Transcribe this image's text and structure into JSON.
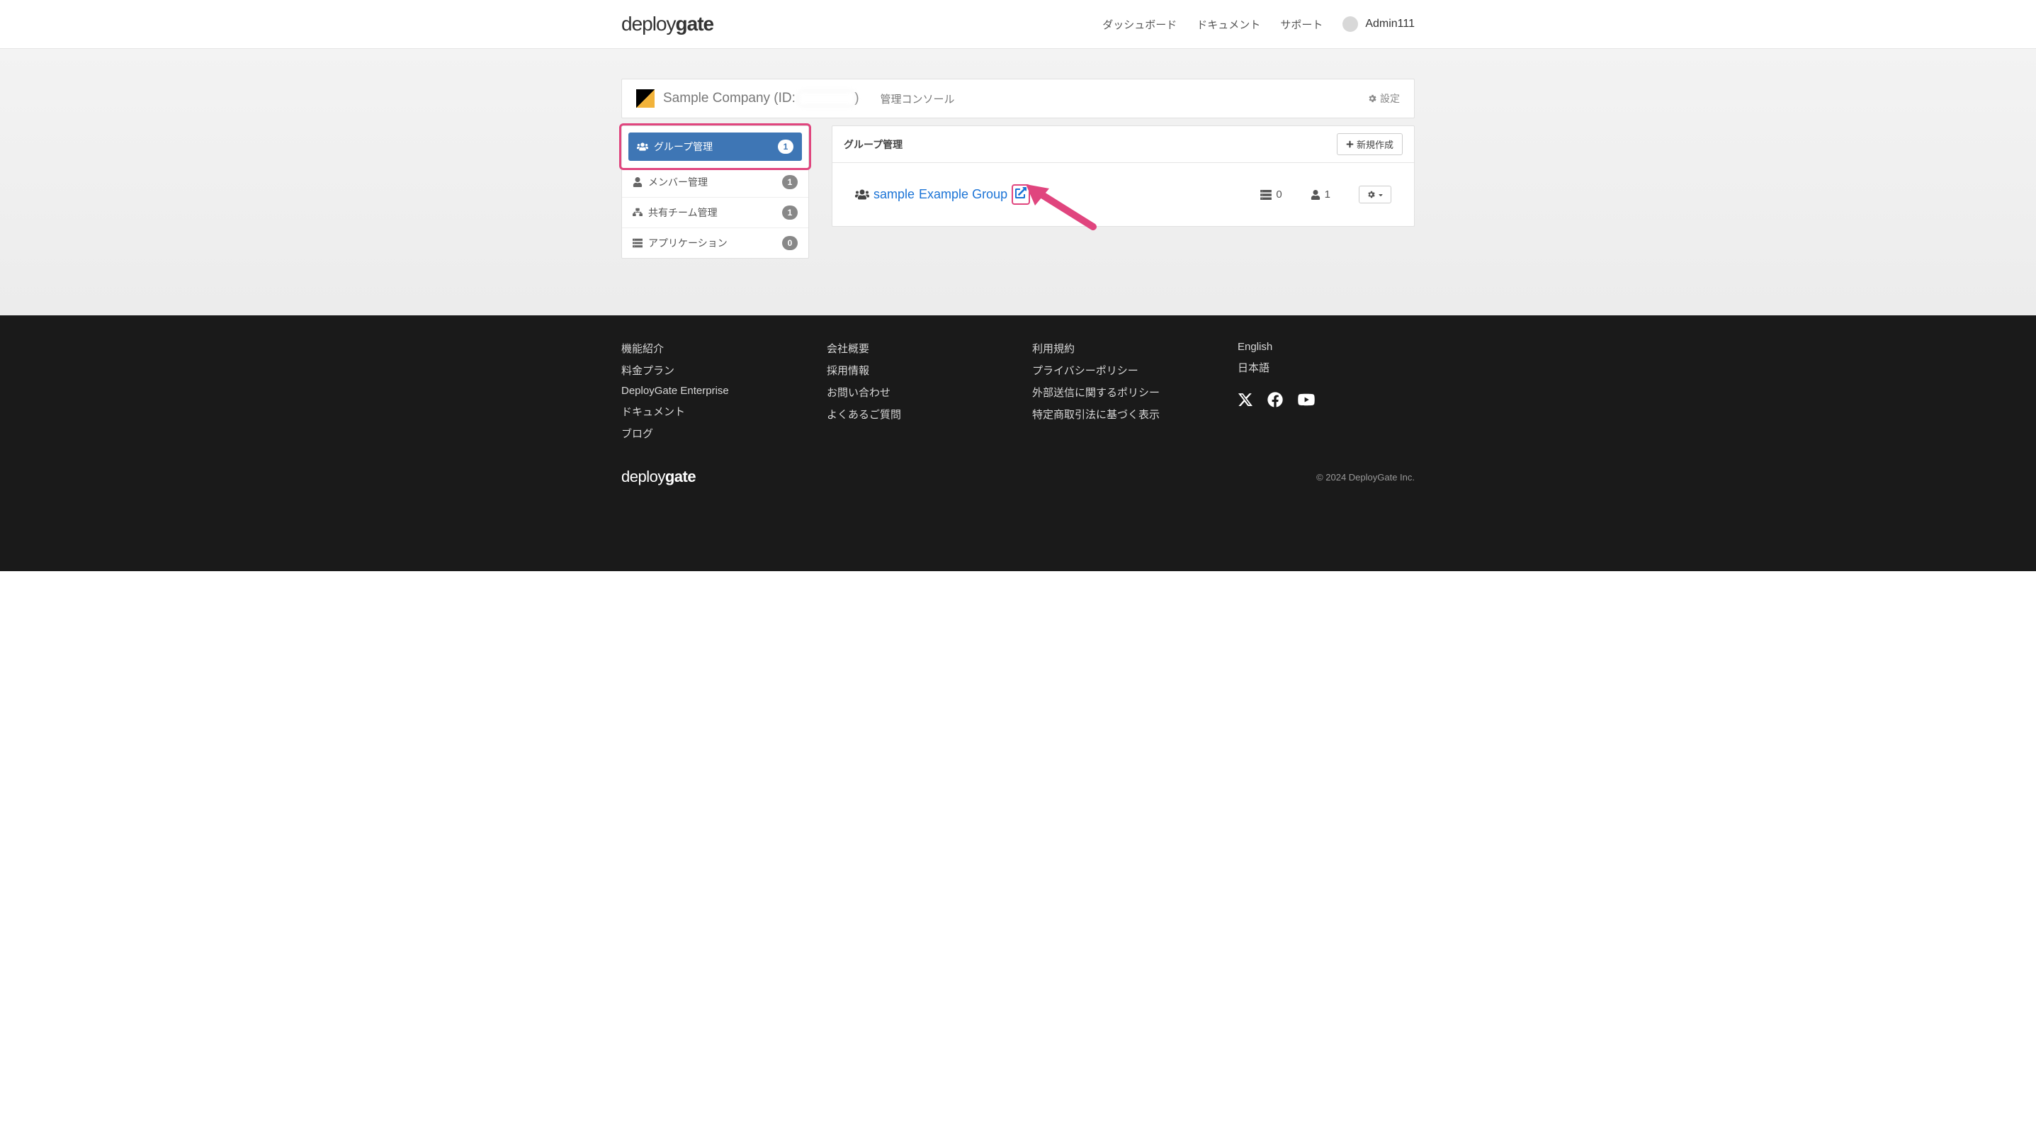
{
  "header": {
    "logo_deploy": "deploy",
    "logo_gate": "gate",
    "nav": {
      "dashboard": "ダッシュボード",
      "documents": "ドキュメント",
      "support": "サポート"
    },
    "user": "Admin111"
  },
  "company": {
    "name_prefix": "Sample Company (ID: ",
    "name_suffix": ")",
    "console_label": "管理コンソール",
    "settings_label": "設定"
  },
  "sidebar": {
    "items": [
      {
        "label": "グループ管理",
        "count": "1"
      },
      {
        "label": "メンバー管理",
        "count": "1"
      },
      {
        "label": "共有チーム管理",
        "count": "1"
      },
      {
        "label": "アプリケーション",
        "count": "0"
      }
    ]
  },
  "main": {
    "panel_title": "グループ管理",
    "new_button": "新規作成",
    "group": {
      "sample": "sample",
      "name": "Example Group",
      "app_count": "0",
      "member_count": "1"
    }
  },
  "footer": {
    "col1": [
      "機能紹介",
      "料金プラン",
      "DeployGate Enterprise",
      "ドキュメント",
      "ブログ"
    ],
    "col2": [
      "会社概要",
      "採用情報",
      "お問い合わせ",
      "よくあるご質問"
    ],
    "col3": [
      "利用規約",
      "プライバシーポリシー",
      "外部送信に関するポリシー",
      "特定商取引法に基づく表示"
    ],
    "col4": [
      "English",
      "日本語"
    ],
    "logo_deploy": "deploy",
    "logo_gate": "gate",
    "copyright": "© 2024 DeployGate Inc."
  }
}
